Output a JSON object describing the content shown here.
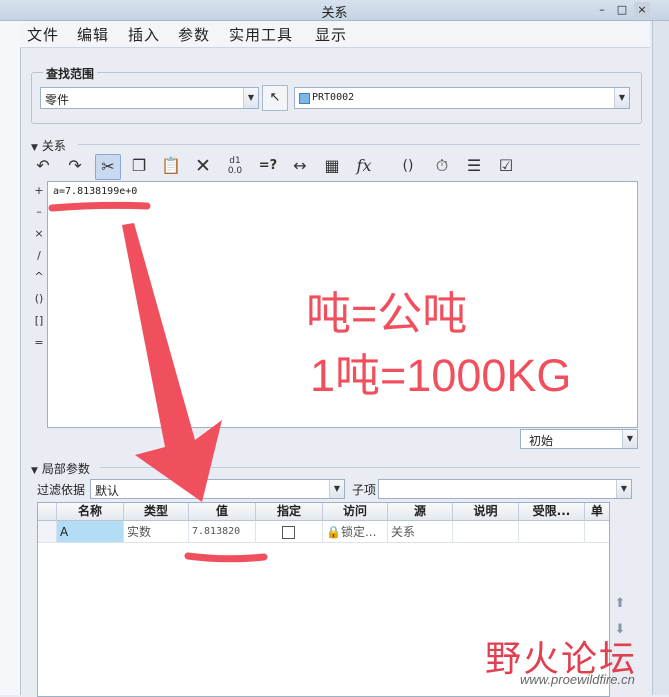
{
  "window": {
    "title": "关系",
    "min_label": "–",
    "max_label": "□",
    "close_label": "×"
  },
  "menu": [
    "文件",
    "编辑",
    "插入",
    "参数",
    "实用工具",
    "显示"
  ],
  "scope": {
    "title": "查找范围",
    "type_value": "零件",
    "model_value": "PRT0002"
  },
  "relations": {
    "title": "关系",
    "operators": [
      "+",
      "–",
      "×",
      "/",
      "^",
      "()",
      "[]",
      "="
    ],
    "text": "a=7.8138199e+0",
    "sort_value": "初始"
  },
  "toolbar_icons": [
    "undo-icon",
    "redo-icon",
    "cut-icon",
    "copy-icon",
    "paste-icon",
    "delete-icon",
    "show-values-icon",
    "verify-icon",
    "dimension-icon",
    "table-icon",
    "function-icon",
    "brackets-icon",
    "eval-icon",
    "sort-icon",
    "verify-relations-icon"
  ],
  "annotation": {
    "line1": "吨=公吨",
    "line2": "1吨=1000KG",
    "color": "#f0505e"
  },
  "local_params": {
    "title": "局部参数",
    "filter_label": "过滤依据",
    "filter_value": "默认",
    "child_label": "子项",
    "columns": [
      "名称",
      "类型",
      "值",
      "指定",
      "访问",
      "源",
      "说明",
      "受限...",
      "单"
    ],
    "rows": [
      {
        "name": "A",
        "type": "实数",
        "value": "7.813820",
        "designate": false,
        "access": "锁定...",
        "source": "关系",
        "desc": "",
        "restricted": ""
      }
    ]
  },
  "watermark": {
    "text": "野火论坛",
    "url": "www.proewildfire.cn"
  }
}
